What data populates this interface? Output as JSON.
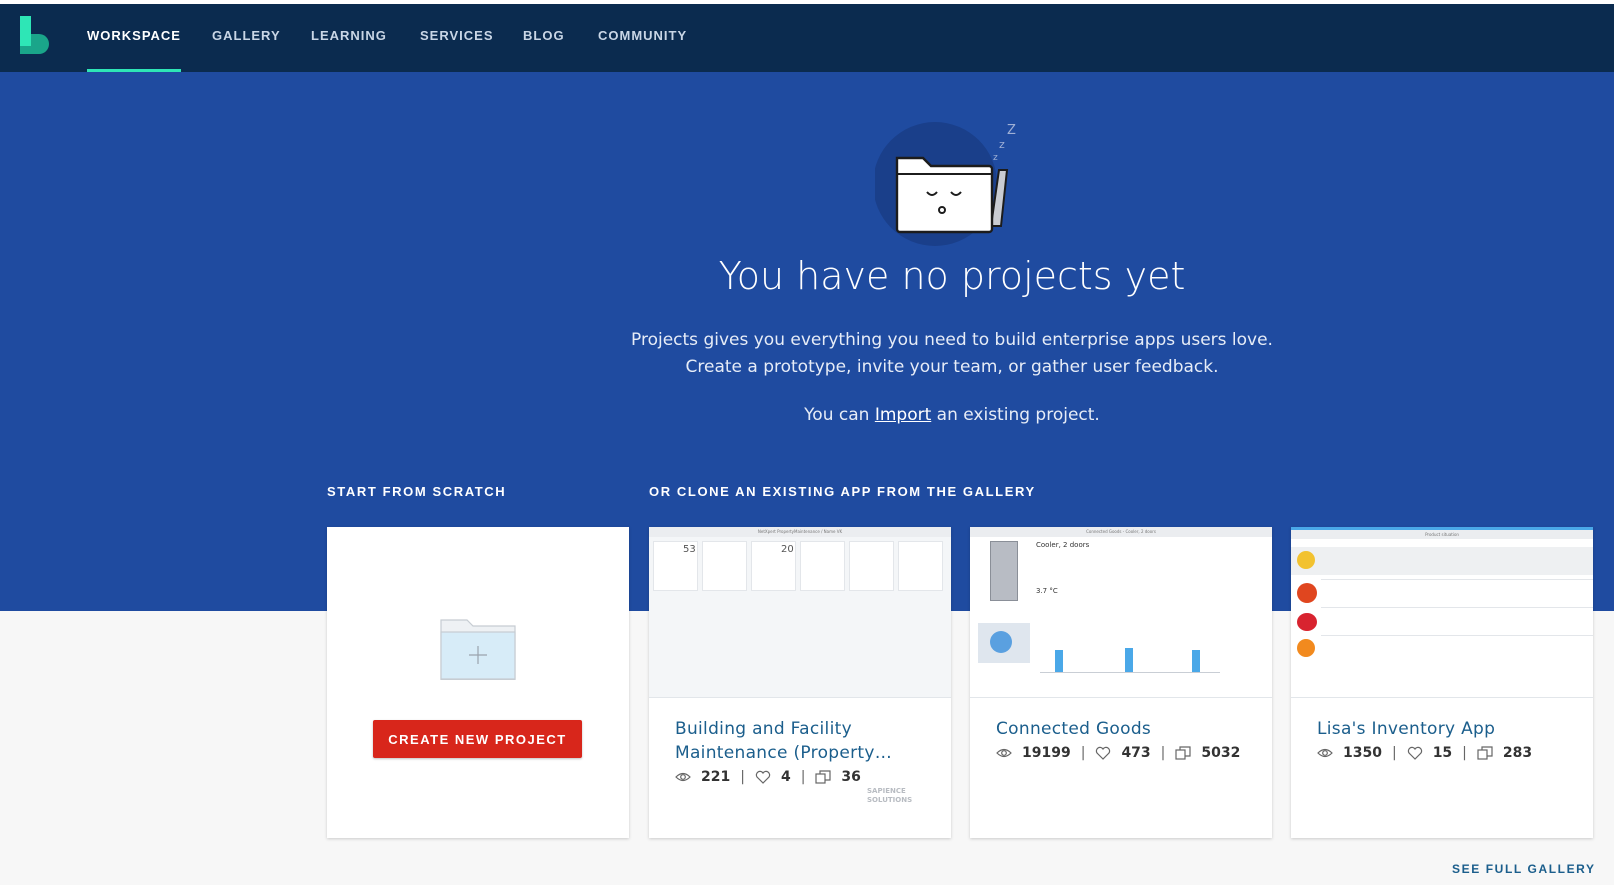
{
  "nav": {
    "items": [
      {
        "label": "WORKSPACE",
        "active": true
      },
      {
        "label": "GALLERY",
        "active": false
      },
      {
        "label": "LEARNING",
        "active": false
      },
      {
        "label": "SERVICES",
        "active": false
      },
      {
        "label": "BLOG",
        "active": false
      },
      {
        "label": "COMMUNITY",
        "active": false
      }
    ]
  },
  "hero": {
    "title": "You have no projects yet",
    "desc_line1": "Projects gives you everything you need to build enterprise apps users love.",
    "desc_line2": "Create a prototype, invite your team, or gather user feedback.",
    "import_prefix": "You can",
    "import_link": "Import",
    "import_suffix": "an existing project."
  },
  "sections": {
    "scratch_label": "START FROM SCRATCH",
    "clone_label": "OR CLONE AN EXISTING APP FROM THE GALLERY"
  },
  "scratch_card": {
    "button_label": "CREATE NEW PROJECT"
  },
  "gallery": [
    {
      "title": "Building and Facility Maintenance (Property…",
      "views": "221",
      "likes": "4",
      "clones": "36",
      "brand": "SAPIENCE SOLUTIONS"
    },
    {
      "title": "Connected Goods",
      "views": "19199",
      "likes": "473",
      "clones": "5032"
    },
    {
      "title": "Lisa's Inventory App",
      "views": "1350",
      "likes": "15",
      "clones": "283"
    }
  ],
  "thumb_text": {
    "bfm_header": "NetXpert PropertyMaintenance / Name VK",
    "bfm_count1": "53",
    "bfm_count2": "20",
    "cg_header": "Connected Goods - Cooler, 2 doors",
    "cg_title": "Cooler, 2 doors",
    "cg_temp": "3.7 °C",
    "lisa_header": "Product situation"
  },
  "footer": {
    "see_full_gallery": "SEE FULL GALLERY"
  },
  "colors": {
    "nav_bg": "#0b2b4f",
    "hero_bg": "#1f4ba0",
    "accent": "#2ee6b6",
    "primary_button": "#d8261b",
    "link": "#1b5e8c"
  }
}
